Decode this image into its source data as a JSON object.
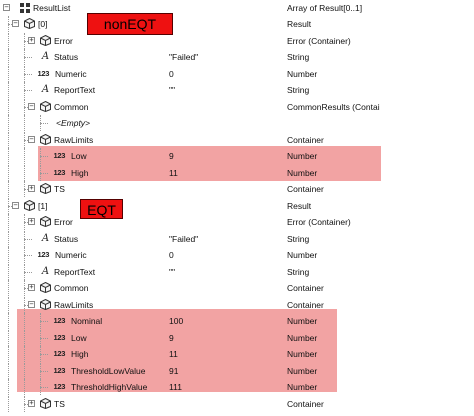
{
  "columns": {
    "name": "ResultList",
    "type": "Array of Result[0..1]"
  },
  "annotations": {
    "noneqt": "nonEQT",
    "eqt": "EQT"
  },
  "colors": {
    "highlight": "#f2a3a3",
    "tag": "#ee1111"
  },
  "rows": [
    {
      "name": "[0]",
      "value": "",
      "type": "Result",
      "icon": "result-icon"
    },
    {
      "name": "Error",
      "value": "",
      "type": "Error (Container)",
      "icon": "container-icon"
    },
    {
      "name": "Status",
      "value": "\"Failed\"",
      "type": "String",
      "icon": "string-icon"
    },
    {
      "name": "Numeric",
      "value": "0",
      "type": "Number",
      "icon": "number-icon"
    },
    {
      "name": "ReportText",
      "value": "\"\"",
      "type": "String",
      "icon": "string-icon"
    },
    {
      "name": "Common",
      "value": "",
      "type": "CommonResults (Contai",
      "icon": "container-icon"
    },
    {
      "name": "<Empty>",
      "value": "",
      "type": "",
      "icon": ""
    },
    {
      "name": "RawLimits",
      "value": "",
      "type": "Container",
      "icon": "container-icon"
    },
    {
      "name": "Low",
      "value": "9",
      "type": "Number",
      "icon": "number-icon"
    },
    {
      "name": "High",
      "value": "11",
      "type": "Number",
      "icon": "number-icon"
    },
    {
      "name": "TS",
      "value": "",
      "type": "Container",
      "icon": "container-icon"
    },
    {
      "name": "[1]",
      "value": "",
      "type": "Result",
      "icon": "result-icon"
    },
    {
      "name": "Error",
      "value": "",
      "type": "Error (Container)",
      "icon": "container-icon"
    },
    {
      "name": "Status",
      "value": "\"Failed\"",
      "type": "String",
      "icon": "string-icon"
    },
    {
      "name": "Numeric",
      "value": "0",
      "type": "Number",
      "icon": "number-icon"
    },
    {
      "name": "ReportText",
      "value": "\"\"",
      "type": "String",
      "icon": "string-icon"
    },
    {
      "name": "Common",
      "value": "",
      "type": "Container",
      "icon": "container-icon"
    },
    {
      "name": "RawLimits",
      "value": "",
      "type": "Container",
      "icon": "container-icon"
    },
    {
      "name": "Nominal",
      "value": "100",
      "type": "Number",
      "icon": "number-icon"
    },
    {
      "name": "Low",
      "value": "9",
      "type": "Number",
      "icon": "number-icon"
    },
    {
      "name": "High",
      "value": "11",
      "type": "Number",
      "icon": "number-icon"
    },
    {
      "name": "ThresholdLowValue",
      "value": "91",
      "type": "Number",
      "icon": "number-icon"
    },
    {
      "name": "ThresholdHighValue",
      "value": "111",
      "type": "Number",
      "icon": "number-icon"
    },
    {
      "name": "TS",
      "value": "",
      "type": "Container",
      "icon": "container-icon"
    }
  ]
}
